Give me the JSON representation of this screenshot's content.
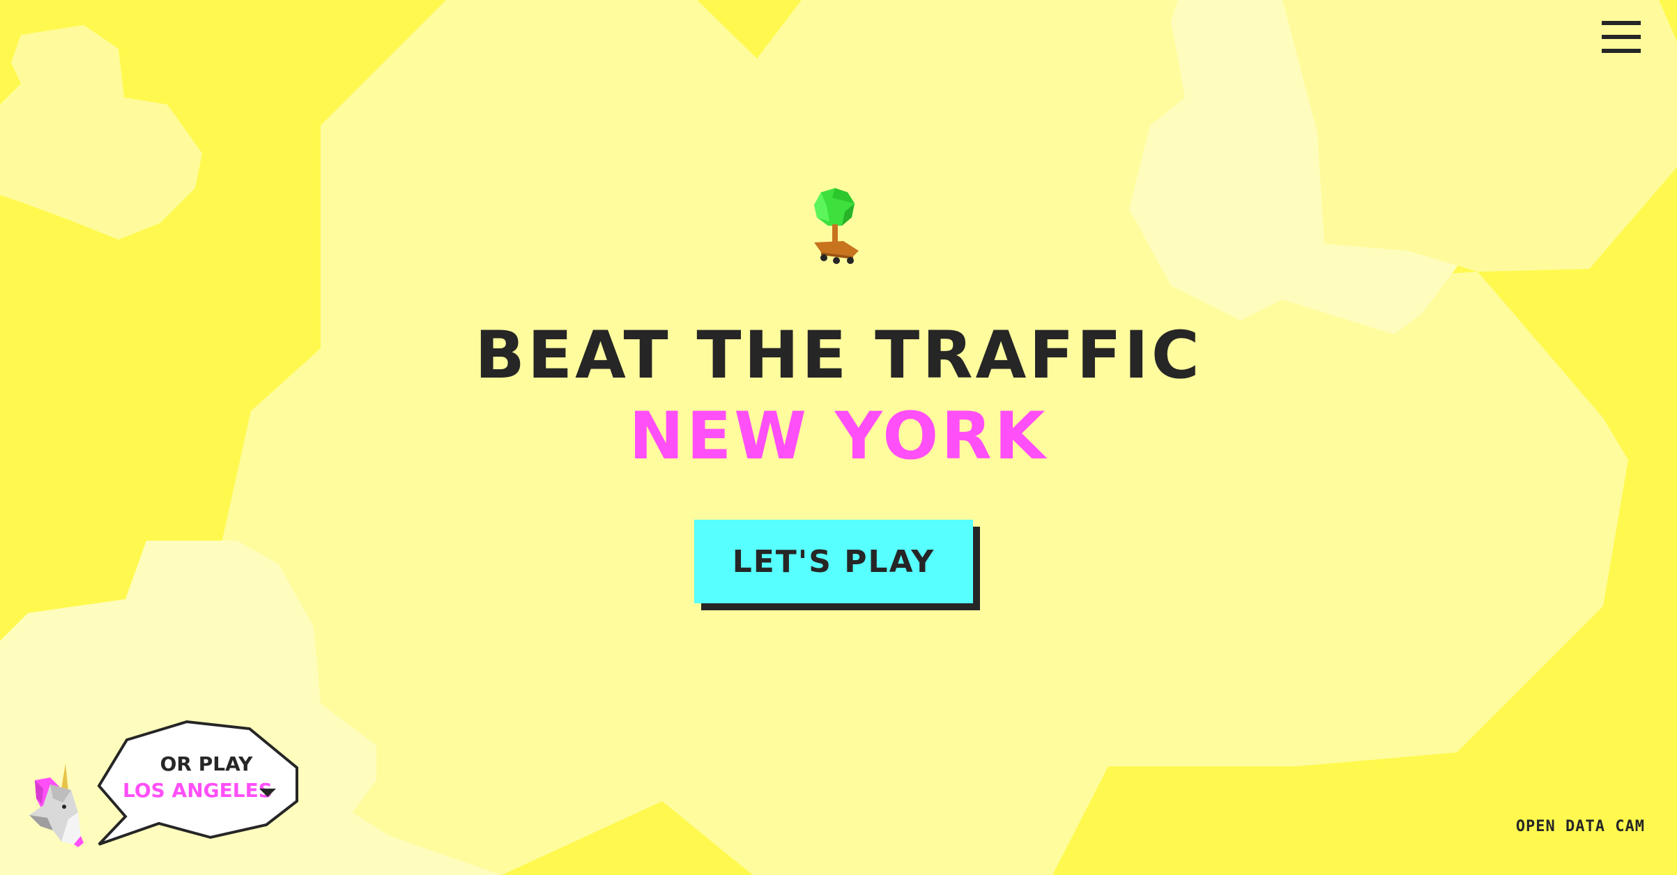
{
  "header": {
    "menu_icon": "hamburger-menu-icon"
  },
  "hero": {
    "illustration_icon": "tree-on-skateboard-icon",
    "headline": "BEAT THE TRAFFIC",
    "city": "NEW YORK",
    "play_label": "LET'S PLAY"
  },
  "city_switch": {
    "mascot_icon": "unicorn-icon",
    "prefix": "OR PLAY",
    "selected_city": "LOS ANGELES",
    "caret_icon": "caret-down-icon"
  },
  "footer": {
    "link_label": "OPEN DATA CAM"
  },
  "colors": {
    "background": "#fff94f",
    "blob_light": "#fffb9c",
    "text_dark": "#262626",
    "accent_pink": "#ff4ff8",
    "button_cyan": "#57fffe",
    "tree_green": "#3ee03e",
    "skateboard_brown": "#c8741f"
  }
}
